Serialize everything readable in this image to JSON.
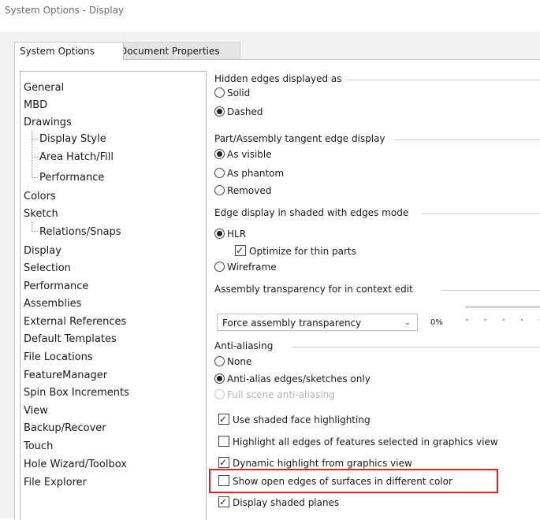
{
  "window": {
    "title": "System Options - Display"
  },
  "tabs": {
    "system_options": "System Options",
    "document_properties": "Document Properties"
  },
  "tree": [
    "General",
    "MBD",
    "Drawings",
    "Display Style",
    "Area Hatch/Fill",
    "Performance",
    "Colors",
    "Sketch",
    "Relations/Snaps",
    "Display",
    "Selection",
    "Performance",
    "Assemblies",
    "External References",
    "Default Templates",
    "File Locations",
    "FeatureManager",
    "Spin Box Increments",
    "View",
    "Backup/Recover",
    "Touch",
    "Hole Wizard/Toolbox",
    "File Explorer"
  ],
  "hidden_edges": {
    "label": "Hidden edges displayed as",
    "solid": "Solid",
    "dashed": "Dashed",
    "selected": "dashed"
  },
  "tangent_edge": {
    "label": "Part/Assembly tangent edge display",
    "visible": "As visible",
    "phantom": "As phantom",
    "removed": "Removed",
    "selected": "visible"
  },
  "shaded_edges": {
    "label": "Edge display in shaded with edges mode",
    "hlr": "HLR",
    "optimize": "Optimize for thin parts",
    "wireframe": "Wireframe",
    "selected": "hlr",
    "optimize_checked": true
  },
  "transparency": {
    "label": "Assembly transparency for in context edit",
    "combo_value": "Force assembly transparency",
    "percent": "0%"
  },
  "anti_aliasing": {
    "label": "Anti-aliasing",
    "none": "None",
    "edges_only": "Anti-alias edges/sketches only",
    "full_scene": "Full scene anti-aliasing",
    "selected": "edges_only"
  },
  "checks": {
    "shaded_face": {
      "label": "Use shaded face highlighting",
      "checked": true
    },
    "highlight_all": {
      "label": "Highlight all edges of features selected in graphics view",
      "checked": false
    },
    "dynamic": {
      "label": "Dynamic highlight from graphics view",
      "checked": true
    },
    "open_edges": {
      "label": "Show open edges of surfaces in different color",
      "checked": false
    },
    "shaded_planes": {
      "label": "Display shaded planes",
      "checked": true
    }
  },
  "colors": {
    "highlight_box": "#e32121"
  }
}
